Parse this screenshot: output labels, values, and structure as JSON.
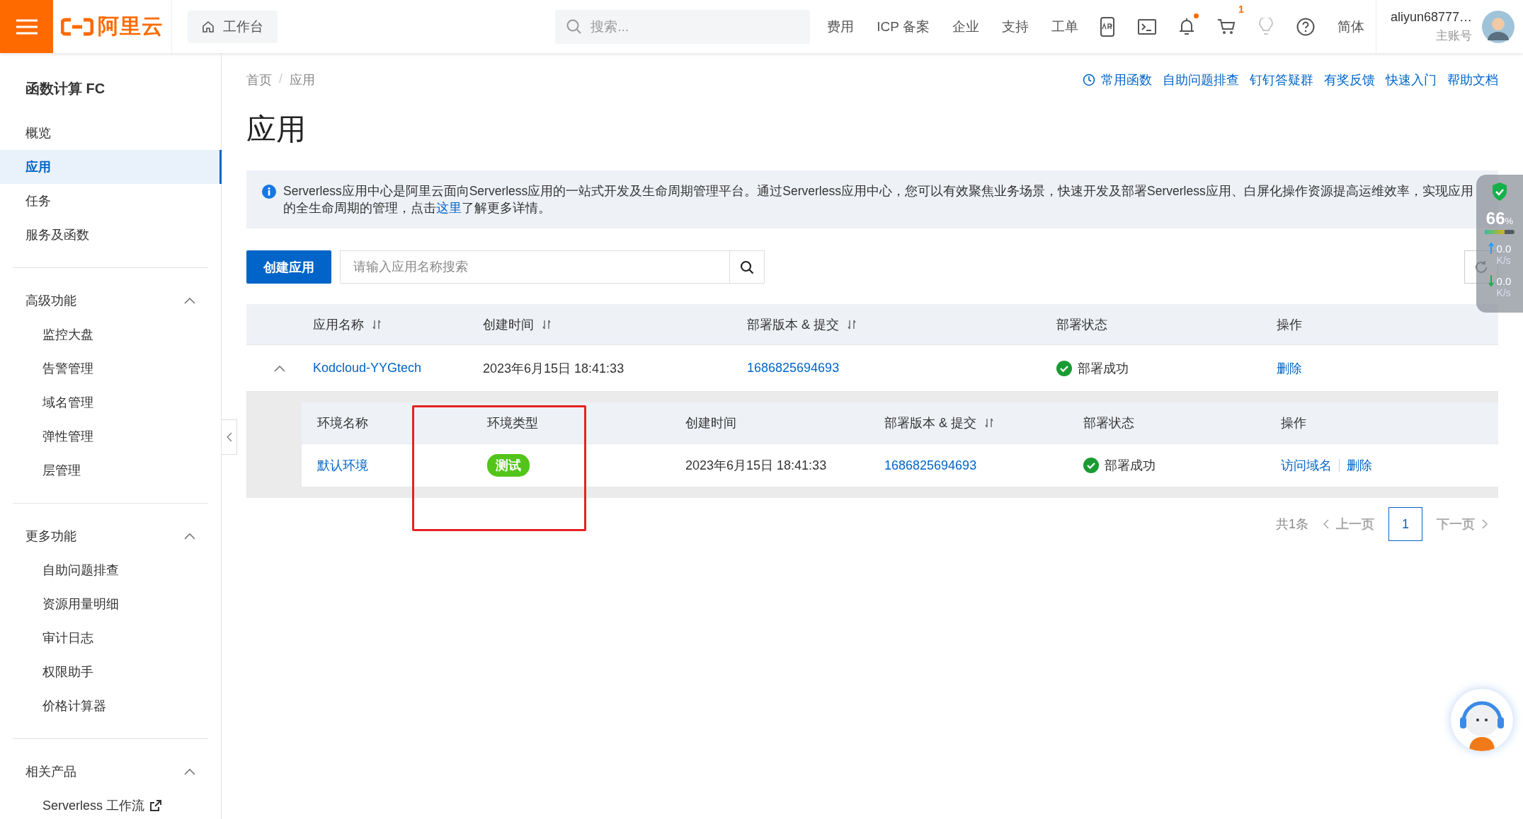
{
  "topbar": {
    "logo": "阿里云",
    "workbench": "工作台",
    "search": {
      "placeholder": "搜索..."
    },
    "nav": [
      "费用",
      "ICP 备案",
      "企业",
      "支持",
      "工单"
    ],
    "tools": [
      {
        "kind": "app",
        "dot": false,
        "disabled": false
      },
      {
        "kind": "terminal",
        "dot": false,
        "disabled": false
      },
      {
        "kind": "bell",
        "dot": true,
        "disabled": false
      },
      {
        "kind": "cart",
        "dot": false,
        "count": "1",
        "disabled": false
      },
      {
        "kind": "bulb",
        "dot": false,
        "disabled": true
      },
      {
        "kind": "help",
        "dot": false,
        "disabled": false
      }
    ],
    "language": "简体",
    "account": {
      "name": "aliyun68777…",
      "role": "主账号"
    }
  },
  "sidebar": {
    "title": "函数计算 FC",
    "items": [
      {
        "label": "概览",
        "selected": false
      },
      {
        "label": "应用",
        "selected": true
      },
      {
        "label": "任务",
        "selected": false
      },
      {
        "label": "服务及函数",
        "selected": false
      }
    ],
    "sections": [
      {
        "title": "高级功能",
        "expanded": true,
        "items": [
          {
            "label": "监控大盘",
            "external": false
          },
          {
            "label": "告警管理",
            "external": false
          },
          {
            "label": "域名管理",
            "external": false
          },
          {
            "label": "弹性管理",
            "external": false
          },
          {
            "label": "层管理",
            "external": false
          }
        ]
      },
      {
        "title": "更多功能",
        "expanded": true,
        "items": [
          {
            "label": "自助问题排查",
            "external": false
          },
          {
            "label": "资源用量明细",
            "external": false
          },
          {
            "label": "审计日志",
            "external": false
          },
          {
            "label": "权限助手",
            "external": false
          },
          {
            "label": "价格计算器",
            "external": false
          }
        ]
      },
      {
        "title": "相关产品",
        "expanded": true,
        "items": [
          {
            "label": "Serverless 工作流",
            "external": true
          }
        ]
      }
    ]
  },
  "breadcrumb": {
    "separator": "/",
    "items": [
      "首页",
      "应用"
    ]
  },
  "quick_links": [
    {
      "label": "常用函数",
      "kind": "icon-link"
    },
    {
      "label": "自助问题排查",
      "kind": "link"
    },
    {
      "label": "钉钉答疑群",
      "kind": "link"
    },
    {
      "label": "有奖反馈",
      "kind": "link"
    },
    {
      "label": "快速入门",
      "kind": "link"
    },
    {
      "label": "帮助文档",
      "kind": "link"
    }
  ],
  "page_title": "应用",
  "banner": {
    "before": "Serverless应用中心是阿里云面向Serverless应用的一站式开发及生命周期管理平台。通过Serverless应用中心，您可以有效聚焦业务场景，快速开发及部署Serverless应用、白屏化操作资源提高运维效率，实现应用的全生命周期的管理，点击",
    "link": "这里",
    "after": "了解更多详情。"
  },
  "toolbar": {
    "create_button": "创建应用",
    "search": {
      "placeholder": "请输入应用名称搜索"
    }
  },
  "table": {
    "columns": [
      {
        "label": "应用名称",
        "sortable": true
      },
      {
        "label": "创建时间",
        "sortable": true
      },
      {
        "label": "部署版本 & 提交",
        "sortable": true
      },
      {
        "label": "部署状态",
        "sortable": false
      },
      {
        "label": "操作",
        "sortable": false
      }
    ],
    "rows": [
      {
        "expanded": true,
        "name": "Kodcloud-YYGtech",
        "created": "2023年6月15日 18:41:33",
        "version": "1686825694693",
        "status": {
          "kind": "success",
          "text": "部署成功"
        },
        "actions": [
          "删除"
        ],
        "environments": {
          "columns": [
            {
              "label": "环境名称",
              "sortable": false
            },
            {
              "label": "环境类型",
              "sortable": false
            },
            {
              "label": "创建时间",
              "sortable": false
            },
            {
              "label": "部署版本 & 提交",
              "sortable": true
            },
            {
              "label": "部署状态",
              "sortable": false
            },
            {
              "label": "操作",
              "sortable": false
            }
          ],
          "rows": [
            {
              "name": "默认环境",
              "type": "测试",
              "created": "2023年6月15日 18:41:33",
              "version": "1686825694693",
              "status": {
                "kind": "success",
                "text": "部署成功"
              },
              "actions": [
                "访问域名",
                "删除"
              ]
            }
          ]
        }
      }
    ]
  },
  "annotation": {
    "kind": "rectangle"
  },
  "pagination": {
    "total": "共1条",
    "prev": {
      "label": "上一页",
      "disabled": true
    },
    "pages": [
      {
        "label": "1",
        "selected": true
      }
    ],
    "next": {
      "label": "下一页",
      "disabled": true
    }
  },
  "monitor": {
    "score": "66",
    "unit": "%",
    "level": 0.66,
    "upload": {
      "value": "0.0",
      "unit": "K/s"
    },
    "download": {
      "value": "0.0",
      "unit": "K/s"
    }
  }
}
